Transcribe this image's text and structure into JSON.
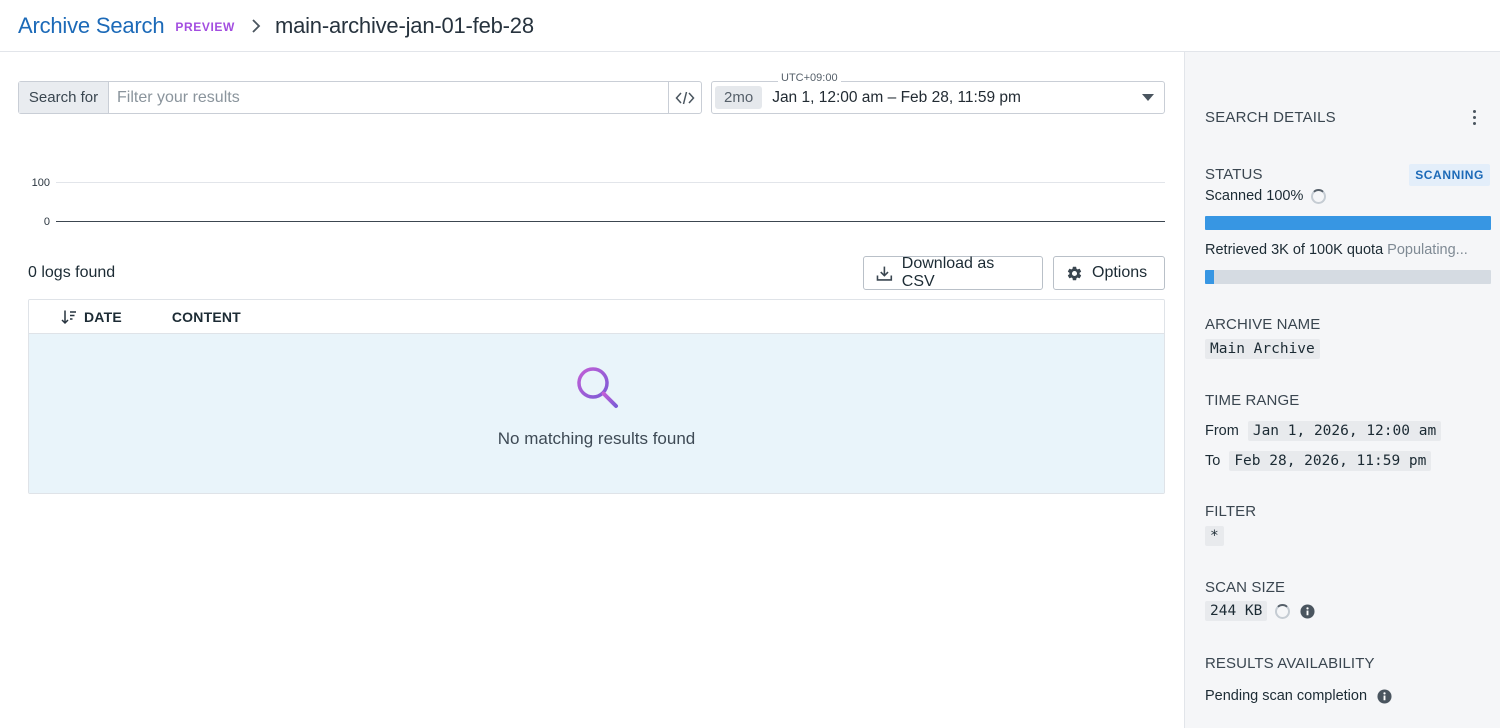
{
  "header": {
    "root": "Archive Search",
    "tag": "PREVIEW",
    "title": "main-archive-jan-01-feb-28"
  },
  "search": {
    "label": "Search for",
    "placeholder": "Filter your results",
    "value": ""
  },
  "timepicker": {
    "timezone": "UTC+09:00",
    "duration": "2mo",
    "range": "Jan 1, 12:00 am – Feb 28, 11:59 pm"
  },
  "chart_data": {
    "type": "bar",
    "y_ticks": [
      "100",
      "0"
    ],
    "ylim": [
      0,
      100
    ],
    "values": []
  },
  "results": {
    "count_text": "0 logs found",
    "download_label": "Download as CSV",
    "options_label": "Options",
    "columns": [
      "DATE",
      "CONTENT"
    ],
    "empty_text": "No matching results found"
  },
  "sidebar": {
    "title": "SEARCH DETAILS",
    "status_label": "STATUS",
    "status_badge": "SCANNING",
    "scanned_text": "Scanned 100%",
    "scan_progress": 1.0,
    "retrieved_text": "Retrieved 3K of 100K quota",
    "retrieved_state": "Populating...",
    "retrieved_progress": 0.03,
    "archive_label": "ARCHIVE NAME",
    "archive_name": "Main Archive",
    "time_range_label": "TIME RANGE",
    "from_label": "From",
    "from_value": "Jan 1, 2026, 12:00 am",
    "to_label": "To",
    "to_value": "Feb 28, 2026, 11:59 pm",
    "filter_label": "FILTER",
    "filter_value": "*",
    "scan_size_label": "SCAN SIZE",
    "scan_size_value": "244 KB",
    "availability_label": "RESULTS AVAILABILITY",
    "availability_value": "Pending scan completion"
  },
  "colors": {
    "link": "#1c6ab8",
    "preview": "#a34ee0",
    "progress": "#3796e3",
    "empty_bg": "#e9f4fa",
    "search_icon": "#a45fd0"
  }
}
